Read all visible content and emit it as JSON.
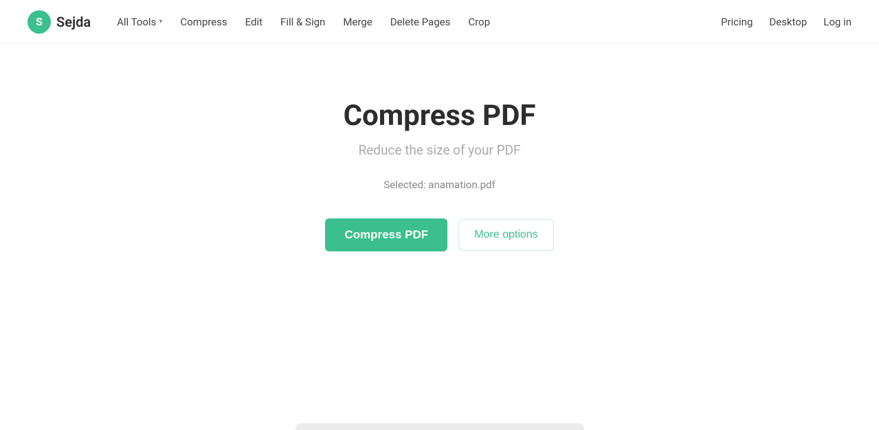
{
  "logo": {
    "icon_letter": "S",
    "text": "Sejda"
  },
  "nav": {
    "all_tools_label": "All Tools",
    "links": [
      {
        "label": "Compress"
      },
      {
        "label": "Edit"
      },
      {
        "label": "Fill & Sign"
      },
      {
        "label": "Merge"
      },
      {
        "label": "Delete Pages"
      },
      {
        "label": "Crop"
      }
    ],
    "right_links": [
      {
        "label": "Pricing"
      },
      {
        "label": "Desktop"
      },
      {
        "label": "Log in"
      }
    ]
  },
  "hero": {
    "title": "Compress PDF",
    "subtitle": "Reduce the size of your PDF",
    "selected_file_label": "Selected: anamation.pdf"
  },
  "actions": {
    "compress_label": "Compress PDF",
    "more_options_label": "More options"
  }
}
